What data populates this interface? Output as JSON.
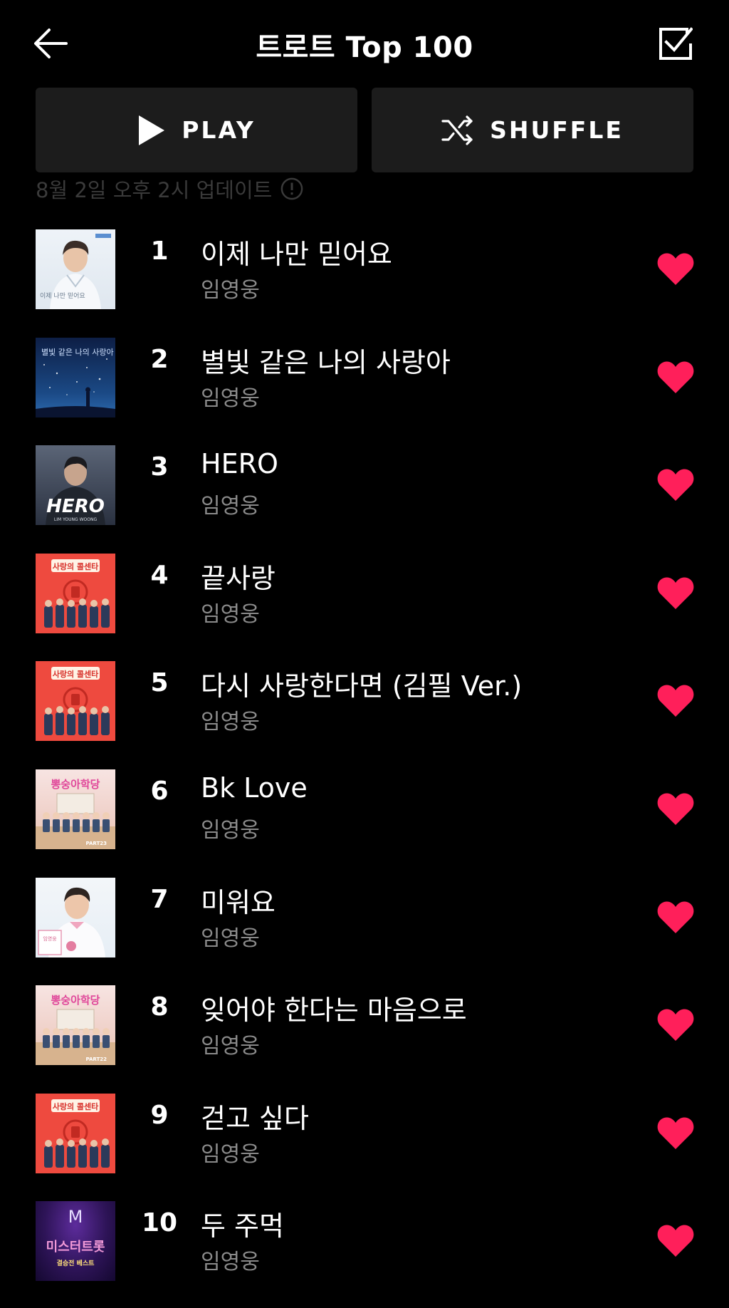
{
  "header": {
    "title": "트로트 Top 100",
    "back_icon": "arrow-left-icon",
    "select_icon": "checkbox-checked-icon"
  },
  "actions": {
    "play_label": "PLAY",
    "shuffle_label": "SHUFFLE"
  },
  "update_note": "8월 2일 오후 2시 업데이트",
  "colors": {
    "background": "#000000",
    "button_bg": "#1c1c1c",
    "heart": "#ff1f5a",
    "artist": "#8a8a8a"
  },
  "tracks": [
    {
      "rank": "1",
      "title": "이제 나만 믿어요",
      "artist": "임영웅",
      "cover_text": "이제 나만 믿어요",
      "liked": true
    },
    {
      "rank": "2",
      "title": "별빛 같은 나의 사랑아",
      "artist": "임영웅",
      "cover_text": "별빛 같은 나의 사랑아",
      "liked": true
    },
    {
      "rank": "3",
      "title": "HERO",
      "artist": "임영웅",
      "cover_text": "HERO",
      "cover_subtext": "LIM YOUNG WOONG",
      "liked": true
    },
    {
      "rank": "4",
      "title": "끝사랑",
      "artist": "임영웅",
      "cover_text": "사랑의 콜센타",
      "liked": true
    },
    {
      "rank": "5",
      "title": "다시 사랑한다면 (김필 Ver.)",
      "artist": "임영웅",
      "cover_text": "사랑의 콜센타",
      "liked": true
    },
    {
      "rank": "6",
      "title": "Bk Love",
      "artist": "임영웅",
      "cover_text": "뽕숭아학당",
      "cover_subtext": "PART23",
      "liked": true
    },
    {
      "rank": "7",
      "title": "미워요",
      "artist": "임영웅",
      "cover_text": "임영웅",
      "liked": true
    },
    {
      "rank": "8",
      "title": "잊어야 한다는 마음으로",
      "artist": "임영웅",
      "cover_text": "뽕숭아학당",
      "cover_subtext": "PART22",
      "liked": true
    },
    {
      "rank": "9",
      "title": "걷고 싶다",
      "artist": "임영웅",
      "cover_text": "사랑의 콜센타",
      "liked": true
    },
    {
      "rank": "10",
      "title": "두 주먹",
      "artist": "임영웅",
      "cover_text": "미스터트롯",
      "cover_subtext": "결승전 베스트",
      "liked": true
    }
  ]
}
